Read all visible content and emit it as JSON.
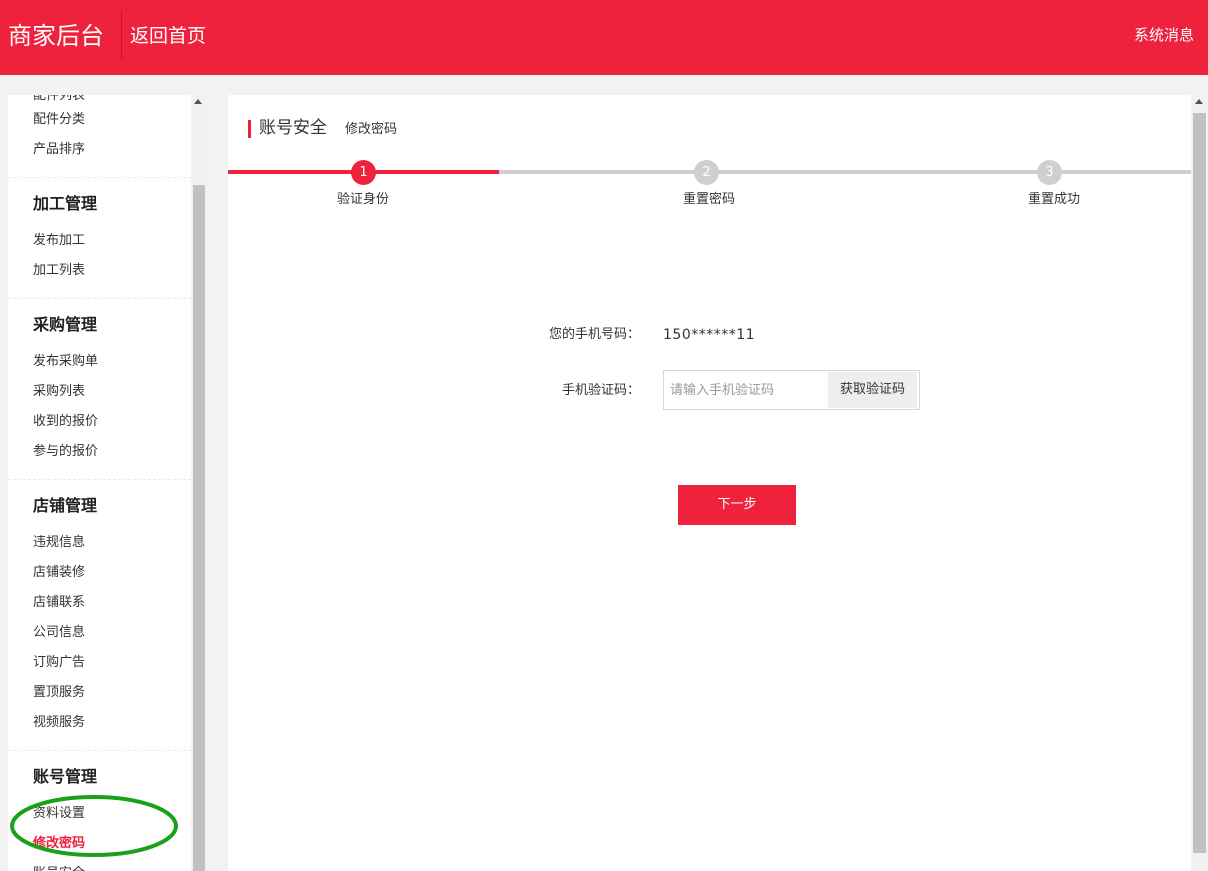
{
  "header": {
    "brand": "商家后台",
    "home_link": "返回首页",
    "system_messages": "系统消息"
  },
  "sidebar": {
    "top_cut_item": "配件列表",
    "groups": [
      {
        "title": "",
        "items": [
          "配件分类",
          "产品排序"
        ]
      },
      {
        "title": "加工管理",
        "items": [
          "发布加工",
          "加工列表"
        ]
      },
      {
        "title": "采购管理",
        "items": [
          "发布采购单",
          "采购列表",
          "收到的报价",
          "参与的报价"
        ]
      },
      {
        "title": "店铺管理",
        "items": [
          "违规信息",
          "店铺装修",
          "店铺联系",
          "公司信息",
          "订购广告",
          "置顶服务",
          "视频服务"
        ]
      },
      {
        "title": "账号管理",
        "items": [
          "资料设置",
          "修改密码",
          "账号安全"
        ]
      }
    ],
    "active_item": "修改密码"
  },
  "main": {
    "title": "账号安全",
    "subtitle": "修改密码",
    "steps": [
      {
        "number": "1",
        "label": "验证身份",
        "state": "active"
      },
      {
        "number": "2",
        "label": "重置密码",
        "state": "inactive"
      },
      {
        "number": "3",
        "label": "重置成功",
        "state": "inactive"
      }
    ],
    "form": {
      "phone_label": "您的手机号码：",
      "phone_value": "150******11",
      "code_label": "手机验证码：",
      "code_placeholder": "请输入手机验证码",
      "get_code_button": "获取验证码",
      "next_button": "下一步"
    }
  },
  "colors": {
    "brand_red": "#ee223c",
    "annotation_green": "#1aa11a",
    "inactive_gray": "#cfcfcf"
  }
}
